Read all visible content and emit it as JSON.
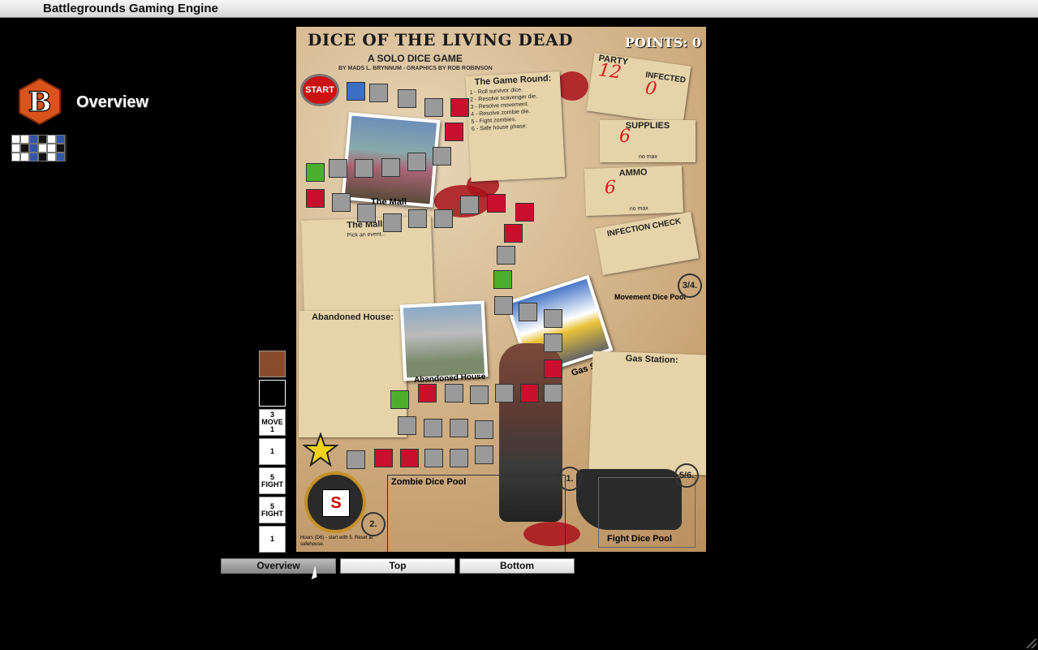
{
  "app": {
    "title": "Battlegrounds Gaming Engine"
  },
  "header": {
    "view_title": "Overview",
    "logo_letter": "B"
  },
  "board": {
    "title": "DICE OF THE LIVING DEAD",
    "subtitle": "A SOLO DICE GAME",
    "credits": "BY MADS L. BRYNNUM - GRAPHICS BY ROB ROBINSON",
    "points": "POINTS: 0",
    "start_label": "START",
    "party_label": "PARTY",
    "party_value": "12",
    "infected_label": "INFECTED",
    "infected_value": "0",
    "supplies_label": "SUPPLIES",
    "supplies_value": "6",
    "ammo_label": "AMMO",
    "ammo_value": "6",
    "no_max": "no max",
    "infection_check": "INFECTION CHECK",
    "game_round_title": "The Game Round:",
    "game_round_steps": [
      "1 - Roll survivor dice.",
      "2 - Resolve scavenger die.",
      "3 - Resolve movement.",
      "4 - Resolve zombie die.",
      "5 - Fight zombies.",
      "6 - Safe house phase:"
    ],
    "mall_photo_label": "The Mall",
    "mall_title": "The Mall:",
    "mall_sub": "Pick an event...",
    "house_title": "Abandoned House:",
    "house_photo_label": "Abandoned House",
    "gas_photo_label": "Gas Station",
    "gas_title": "Gas Station:",
    "movement_pool": "Movement Dice Pool",
    "zombie_pool": "Zombie Dice Pool",
    "fight_pool": "Fight Dice Pool",
    "circle_34": "3/4.",
    "circle_56": "5/6.",
    "circle_1": "1.",
    "circle_2": "2.",
    "clock_letter": "S",
    "hours_note": "Hours (D6) - start with 5. Reset at safehouse."
  },
  "dice_tiles": [
    {
      "label": "",
      "style": "first"
    },
    {
      "label": "",
      "style": "dark"
    },
    {
      "label": "3 MOVE 1",
      "style": ""
    },
    {
      "label": "1",
      "style": ""
    },
    {
      "label": "5 FIGHT",
      "style": ""
    },
    {
      "label": "5 FIGHT",
      "style": ""
    },
    {
      "label": "1",
      "style": ""
    }
  ],
  "tabs": [
    {
      "label": "Overview",
      "active": true
    },
    {
      "label": "Top",
      "active": false
    },
    {
      "label": "Bottom",
      "active": false
    }
  ],
  "colors": {
    "red_space": "#c8102e",
    "green_space": "#4caf2c",
    "gray_space": "#9a9a9a"
  }
}
